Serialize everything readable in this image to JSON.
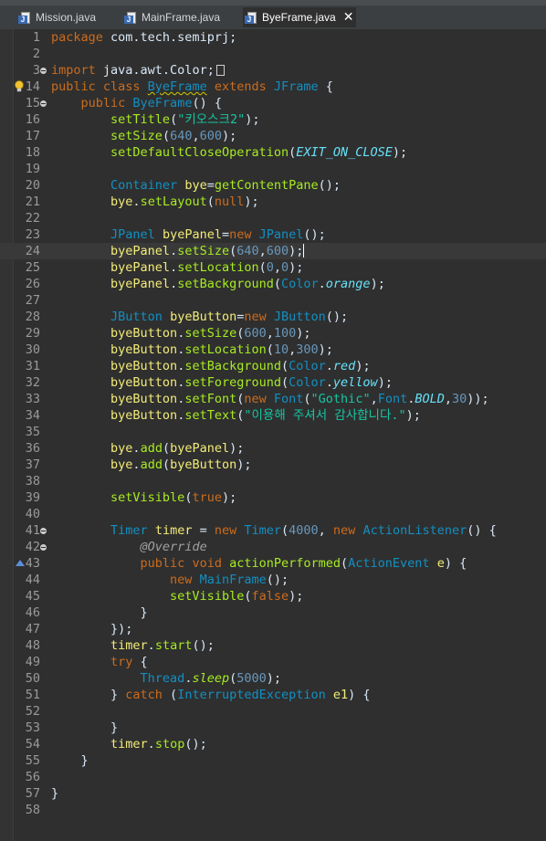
{
  "tabs": [
    {
      "label": "Mission.java",
      "active": false
    },
    {
      "label": "MainFrame.java",
      "active": false
    },
    {
      "label": "ByeFrame.java",
      "active": true
    }
  ],
  "tab_close_glyph": "✕",
  "java_icon_letter": "J",
  "cursor_line": 24,
  "lines": [
    {
      "n": "1",
      "fold": false,
      "code": [
        [
          "kw",
          "package "
        ],
        [
          "",
          "com.tech.semiprj;"
        ]
      ]
    },
    {
      "n": "2",
      "fold": false,
      "code": []
    },
    {
      "n": "3",
      "fold": true,
      "code": [
        [
          "kw",
          "import "
        ],
        [
          "",
          "java.awt.Color;"
        ],
        [
          "box",
          ""
        ]
      ]
    },
    {
      "n": "14",
      "fold": false,
      "marker": "warning",
      "code": [
        [
          "kw",
          "public class "
        ],
        [
          "ty sq",
          "ByeFrame"
        ],
        [
          "kw",
          " extends "
        ],
        [
          "ty",
          "JFrame"
        ],
        [
          "",
          " {"
        ]
      ]
    },
    {
      "n": "15",
      "fold": true,
      "code": [
        [
          "",
          "    "
        ],
        [
          "kw",
          "public "
        ],
        [
          "ty",
          "ByeFrame"
        ],
        [
          "",
          "() {"
        ]
      ]
    },
    {
      "n": "16",
      "fold": false,
      "code": [
        [
          "",
          "        "
        ],
        [
          "mth",
          "setTitle"
        ],
        [
          "",
          "("
        ],
        [
          "str",
          "\"키오스크2\""
        ],
        [
          "",
          ");"
        ]
      ]
    },
    {
      "n": "17",
      "fold": false,
      "code": [
        [
          "",
          "        "
        ],
        [
          "mth",
          "setSize"
        ],
        [
          "",
          "("
        ],
        [
          "num",
          "640"
        ],
        [
          "",
          ","
        ],
        [
          "num",
          "600"
        ],
        [
          "",
          ");"
        ]
      ]
    },
    {
      "n": "18",
      "fold": false,
      "code": [
        [
          "",
          "        "
        ],
        [
          "mth",
          "setDefaultCloseOperation"
        ],
        [
          "",
          "("
        ],
        [
          "fld it",
          "EXIT_ON_CLOSE"
        ],
        [
          "",
          ");"
        ]
      ]
    },
    {
      "n": "19",
      "fold": false,
      "code": []
    },
    {
      "n": "20",
      "fold": false,
      "code": [
        [
          "",
          "        "
        ],
        [
          "ty",
          "Container "
        ],
        [
          "var",
          "bye"
        ],
        [
          "",
          "="
        ],
        [
          "mth",
          "getContentPane"
        ],
        [
          "",
          "();"
        ]
      ]
    },
    {
      "n": "21",
      "fold": false,
      "code": [
        [
          "",
          "        "
        ],
        [
          "var",
          "bye"
        ],
        [
          "",
          "."
        ],
        [
          "mth",
          "setLayout"
        ],
        [
          "",
          "("
        ],
        [
          "kw",
          "null"
        ],
        [
          "",
          ");"
        ]
      ]
    },
    {
      "n": "22",
      "fold": false,
      "code": []
    },
    {
      "n": "23",
      "fold": false,
      "code": [
        [
          "",
          "        "
        ],
        [
          "ty",
          "JPanel "
        ],
        [
          "var",
          "byePanel"
        ],
        [
          "",
          "="
        ],
        [
          "kw",
          "new "
        ],
        [
          "ty",
          "JPanel"
        ],
        [
          "",
          "();"
        ]
      ]
    },
    {
      "n": "24",
      "fold": false,
      "code": [
        [
          "",
          "        "
        ],
        [
          "var",
          "byePanel"
        ],
        [
          "",
          "."
        ],
        [
          "mth",
          "setSize"
        ],
        [
          "",
          "("
        ],
        [
          "num",
          "640"
        ],
        [
          "",
          ","
        ],
        [
          "num",
          "600"
        ],
        [
          "",
          ");"
        ],
        [
          "caret",
          ""
        ]
      ]
    },
    {
      "n": "25",
      "fold": false,
      "code": [
        [
          "",
          "        "
        ],
        [
          "var",
          "byePanel"
        ],
        [
          "",
          "."
        ],
        [
          "mth",
          "setLocation"
        ],
        [
          "",
          "("
        ],
        [
          "num",
          "0"
        ],
        [
          "",
          ","
        ],
        [
          "num",
          "0"
        ],
        [
          "",
          ");"
        ]
      ]
    },
    {
      "n": "26",
      "fold": false,
      "code": [
        [
          "",
          "        "
        ],
        [
          "var",
          "byePanel"
        ],
        [
          "",
          "."
        ],
        [
          "mth",
          "setBackground"
        ],
        [
          "",
          "("
        ],
        [
          "ty",
          "Color"
        ],
        [
          "",
          "."
        ],
        [
          "fld it",
          "orange"
        ],
        [
          "",
          ");"
        ]
      ]
    },
    {
      "n": "27",
      "fold": false,
      "code": []
    },
    {
      "n": "28",
      "fold": false,
      "code": [
        [
          "",
          "        "
        ],
        [
          "ty",
          "JButton "
        ],
        [
          "var",
          "byeButton"
        ],
        [
          "",
          "="
        ],
        [
          "kw",
          "new "
        ],
        [
          "ty",
          "JButton"
        ],
        [
          "",
          "();"
        ]
      ]
    },
    {
      "n": "29",
      "fold": false,
      "code": [
        [
          "",
          "        "
        ],
        [
          "var",
          "byeButton"
        ],
        [
          "",
          "."
        ],
        [
          "mth",
          "setSize"
        ],
        [
          "",
          "("
        ],
        [
          "num",
          "600"
        ],
        [
          "",
          ","
        ],
        [
          "num",
          "100"
        ],
        [
          "",
          ");"
        ]
      ]
    },
    {
      "n": "30",
      "fold": false,
      "code": [
        [
          "",
          "        "
        ],
        [
          "var",
          "byeButton"
        ],
        [
          "",
          "."
        ],
        [
          "mth",
          "setLocation"
        ],
        [
          "",
          "("
        ],
        [
          "num",
          "10"
        ],
        [
          "",
          ","
        ],
        [
          "num",
          "300"
        ],
        [
          "",
          ");"
        ]
      ]
    },
    {
      "n": "31",
      "fold": false,
      "code": [
        [
          "",
          "        "
        ],
        [
          "var",
          "byeButton"
        ],
        [
          "",
          "."
        ],
        [
          "mth",
          "setBackground"
        ],
        [
          "",
          "("
        ],
        [
          "ty",
          "Color"
        ],
        [
          "",
          "."
        ],
        [
          "fld it",
          "red"
        ],
        [
          "",
          ");"
        ]
      ]
    },
    {
      "n": "32",
      "fold": false,
      "code": [
        [
          "",
          "        "
        ],
        [
          "var",
          "byeButton"
        ],
        [
          "",
          "."
        ],
        [
          "mth",
          "setForeground"
        ],
        [
          "",
          "("
        ],
        [
          "ty",
          "Color"
        ],
        [
          "",
          "."
        ],
        [
          "fld it",
          "yellow"
        ],
        [
          "",
          ");"
        ]
      ]
    },
    {
      "n": "33",
      "fold": false,
      "code": [
        [
          "",
          "        "
        ],
        [
          "var",
          "byeButton"
        ],
        [
          "",
          "."
        ],
        [
          "mth",
          "setFont"
        ],
        [
          "",
          "("
        ],
        [
          "kw",
          "new "
        ],
        [
          "ty",
          "Font"
        ],
        [
          "",
          "("
        ],
        [
          "str",
          "\"Gothic\""
        ],
        [
          "",
          ","
        ],
        [
          "ty",
          "Font"
        ],
        [
          "",
          "."
        ],
        [
          "fld it",
          "BOLD"
        ],
        [
          "",
          ","
        ],
        [
          "num",
          "30"
        ],
        [
          "",
          "));"
        ]
      ]
    },
    {
      "n": "34",
      "fold": false,
      "code": [
        [
          "",
          "        "
        ],
        [
          "var",
          "byeButton"
        ],
        [
          "",
          "."
        ],
        [
          "mth",
          "setText"
        ],
        [
          "",
          "("
        ],
        [
          "str",
          "\"이용해 주셔서 감사합니다.\""
        ],
        [
          "",
          ");"
        ]
      ]
    },
    {
      "n": "35",
      "fold": false,
      "code": []
    },
    {
      "n": "36",
      "fold": false,
      "code": [
        [
          "",
          "        "
        ],
        [
          "var",
          "bye"
        ],
        [
          "",
          "."
        ],
        [
          "mth",
          "add"
        ],
        [
          "",
          "("
        ],
        [
          "var",
          "byePanel"
        ],
        [
          "",
          ");"
        ]
      ]
    },
    {
      "n": "37",
      "fold": false,
      "code": [
        [
          "",
          "        "
        ],
        [
          "var",
          "bye"
        ],
        [
          "",
          "."
        ],
        [
          "mth",
          "add"
        ],
        [
          "",
          "("
        ],
        [
          "var",
          "byeButton"
        ],
        [
          "",
          ");"
        ]
      ]
    },
    {
      "n": "38",
      "fold": false,
      "code": []
    },
    {
      "n": "39",
      "fold": false,
      "code": [
        [
          "",
          "        "
        ],
        [
          "mth",
          "setVisible"
        ],
        [
          "",
          "("
        ],
        [
          "kw",
          "true"
        ],
        [
          "",
          ");"
        ]
      ]
    },
    {
      "n": "40",
      "fold": false,
      "code": []
    },
    {
      "n": "41",
      "fold": true,
      "code": [
        [
          "",
          "        "
        ],
        [
          "ty",
          "Timer "
        ],
        [
          "var",
          "timer"
        ],
        [
          "",
          " = "
        ],
        [
          "kw",
          "new "
        ],
        [
          "ty",
          "Timer"
        ],
        [
          "",
          "("
        ],
        [
          "num",
          "4000"
        ],
        [
          "",
          ", "
        ],
        [
          "kw",
          "new "
        ],
        [
          "ty",
          "ActionListener"
        ],
        [
          "",
          "() {"
        ]
      ]
    },
    {
      "n": "42",
      "fold": true,
      "code": [
        [
          "",
          "            "
        ],
        [
          "annot",
          "@Override"
        ]
      ]
    },
    {
      "n": "43",
      "fold": false,
      "marker": "override",
      "code": [
        [
          "",
          "            "
        ],
        [
          "kw",
          "public void "
        ],
        [
          "mth",
          "actionPerformed"
        ],
        [
          "",
          "("
        ],
        [
          "ty",
          "ActionEvent "
        ],
        [
          "var",
          "e"
        ],
        [
          "",
          ") {"
        ]
      ]
    },
    {
      "n": "44",
      "fold": false,
      "code": [
        [
          "",
          "                "
        ],
        [
          "kw",
          "new "
        ],
        [
          "ty",
          "MainFrame"
        ],
        [
          "",
          "();"
        ]
      ]
    },
    {
      "n": "45",
      "fold": false,
      "code": [
        [
          "",
          "                "
        ],
        [
          "mth",
          "setVisible"
        ],
        [
          "",
          "("
        ],
        [
          "kw",
          "false"
        ],
        [
          "",
          ");"
        ]
      ]
    },
    {
      "n": "46",
      "fold": false,
      "code": [
        [
          "",
          "            }"
        ]
      ]
    },
    {
      "n": "47",
      "fold": false,
      "code": [
        [
          "",
          "        });"
        ]
      ]
    },
    {
      "n": "48",
      "fold": false,
      "code": [
        [
          "",
          "        "
        ],
        [
          "var",
          "timer"
        ],
        [
          "",
          "."
        ],
        [
          "mth",
          "start"
        ],
        [
          "",
          "();"
        ]
      ]
    },
    {
      "n": "49",
      "fold": false,
      "code": [
        [
          "",
          "        "
        ],
        [
          "kw",
          "try"
        ],
        [
          "",
          " {"
        ]
      ]
    },
    {
      "n": "50",
      "fold": false,
      "code": [
        [
          "",
          "            "
        ],
        [
          "ty",
          "Thread"
        ],
        [
          "",
          "."
        ],
        [
          "mth it",
          "sleep"
        ],
        [
          "",
          "("
        ],
        [
          "num",
          "5000"
        ],
        [
          "",
          ");"
        ]
      ]
    },
    {
      "n": "51",
      "fold": false,
      "code": [
        [
          "",
          "        } "
        ],
        [
          "kw",
          "catch"
        ],
        [
          "",
          " ("
        ],
        [
          "ty",
          "InterruptedException "
        ],
        [
          "var",
          "e1"
        ],
        [
          "",
          ") {"
        ]
      ]
    },
    {
      "n": "52",
      "fold": false,
      "code": []
    },
    {
      "n": "53",
      "fold": false,
      "code": [
        [
          "",
          "        }"
        ]
      ]
    },
    {
      "n": "54",
      "fold": false,
      "code": [
        [
          "",
          "        "
        ],
        [
          "var",
          "timer"
        ],
        [
          "",
          "."
        ],
        [
          "mth",
          "stop"
        ],
        [
          "",
          "();"
        ]
      ]
    },
    {
      "n": "55",
      "fold": false,
      "code": [
        [
          "",
          "    }"
        ]
      ]
    },
    {
      "n": "56",
      "fold": false,
      "code": []
    },
    {
      "n": "57",
      "fold": false,
      "code": [
        [
          "",
          "}"
        ]
      ]
    },
    {
      "n": "58",
      "fold": false,
      "code": []
    }
  ]
}
